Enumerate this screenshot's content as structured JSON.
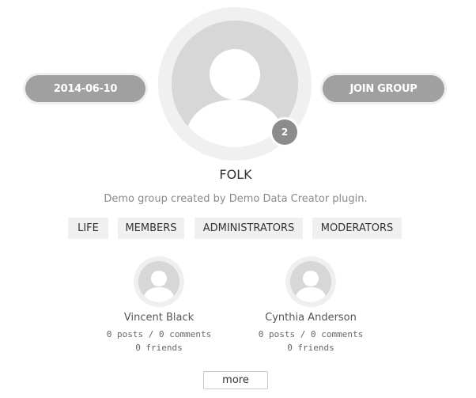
{
  "group": {
    "created_date": "2014-06-10",
    "join_label": "JOIN GROUP",
    "member_count": "2",
    "title": "FOLK",
    "description": "Demo group created by Demo Data Creator plugin."
  },
  "tabs": [
    {
      "label": "LIFE"
    },
    {
      "label": "MEMBERS"
    },
    {
      "label": "ADMINISTRATORS"
    },
    {
      "label": "MODERATORS"
    }
  ],
  "members": [
    {
      "name": "Vincent Black",
      "stats": "0 posts / 0 comments",
      "friends": "0 friends"
    },
    {
      "name": "Cynthia Anderson",
      "stats": "0 posts / 0 comments",
      "friends": "0 friends"
    }
  ],
  "more_label": "more",
  "icons": {
    "group_avatar": "default-avatar-icon",
    "member_avatar": "default-avatar-icon"
  },
  "colors": {
    "pill": "#a0a0a0",
    "ring": "#f0f0f0",
    "badge": "#8c8c8c",
    "tab_bg": "#f0f0f0"
  }
}
